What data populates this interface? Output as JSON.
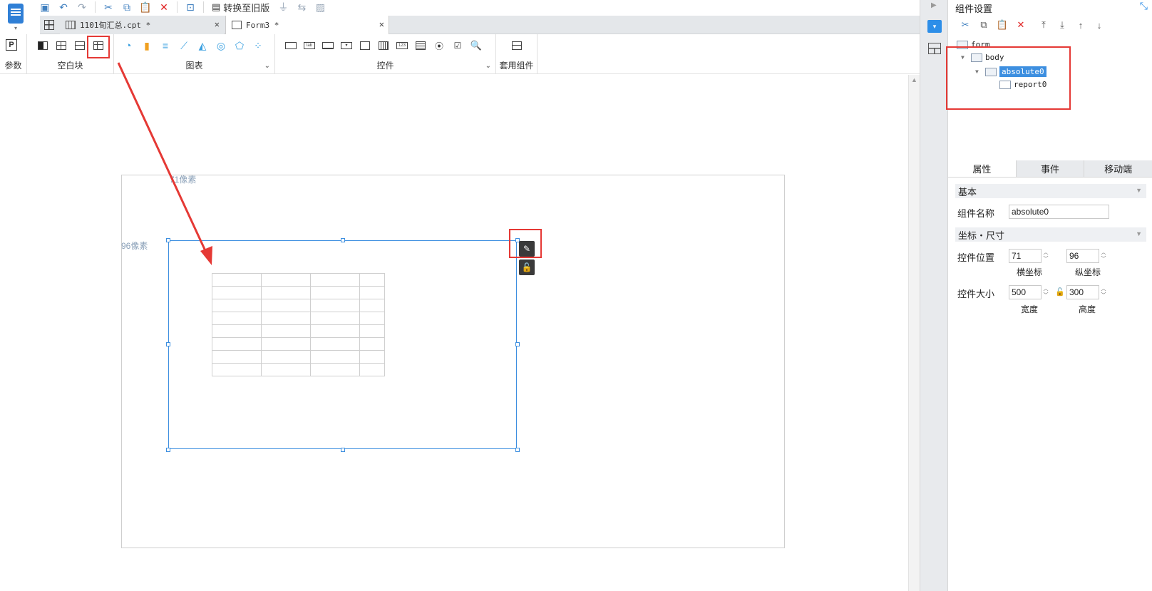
{
  "quickbar": {
    "convert_label": "转换至旧版"
  },
  "tabs": [
    {
      "label": "1101旬汇总.cpt *"
    },
    {
      "label": "Form3 *"
    }
  ],
  "ribbon": {
    "params_label": "参数",
    "blank_label": "空白块",
    "chart_label": "图表",
    "control_label": "控件",
    "template_label": "套用组件"
  },
  "canvas": {
    "x_ruler_label": "71像素",
    "y_ruler_label": "96像素"
  },
  "right_panel": {
    "title": "组件设置",
    "tree": {
      "root": "form",
      "body": "body",
      "absolute": "absolute0",
      "report": "report0"
    },
    "tabs": [
      "属性",
      "事件",
      "移动端"
    ],
    "basic_section": "基本",
    "name_label": "组件名称",
    "name_value": "absolute0",
    "coord_section": "坐标・尺寸",
    "position_label": "控件位置",
    "x_value": "71",
    "y_value": "96",
    "x_sublabel": "横坐标",
    "y_sublabel": "纵坐标",
    "size_label": "控件大小",
    "width_value": "500",
    "height_value": "300",
    "width_sublabel": "宽度",
    "height_sublabel": "高度"
  },
  "colors": {
    "accent": "#3d8fe0",
    "highlight_red": "#e53935"
  }
}
